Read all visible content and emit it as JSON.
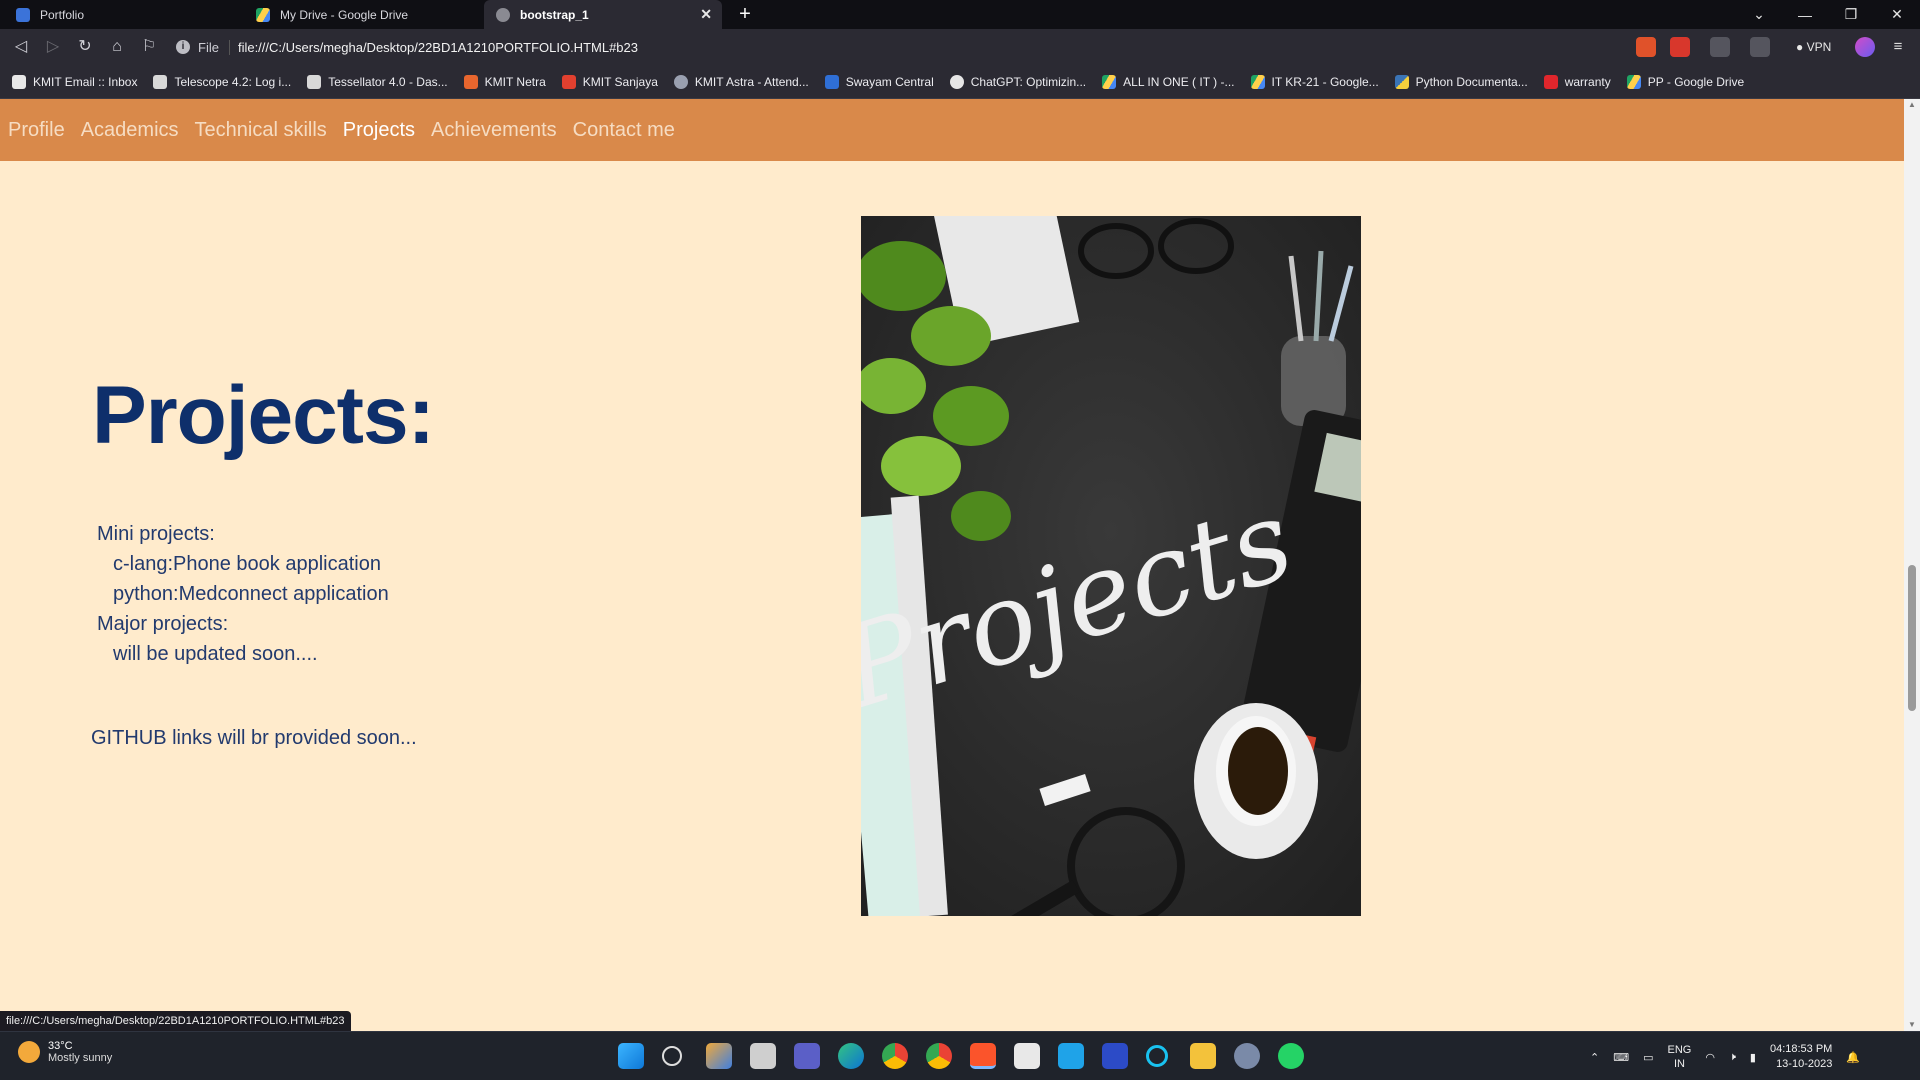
{
  "browser": {
    "tabs": [
      {
        "label": "Portfolio",
        "active": false
      },
      {
        "label": "My Drive - Google Drive",
        "active": false
      },
      {
        "label": "bootstrap_1",
        "active": true
      }
    ],
    "address": {
      "scheme_label": "File",
      "url": "file:///C:/Users/megha/Desktop/22BD1A1210PORTFOLIO.HTML#b23"
    },
    "vpn_label": "VPN",
    "bookmarks": [
      "KMIT Email :: Inbox",
      "Telescope 4.2: Log i...",
      "Tessellator 4.0 - Das...",
      "KMIT Netra",
      "KMIT Sanjaya",
      "KMIT Astra - Attend...",
      "Swayam Central",
      "ChatGPT: Optimizin...",
      "ALL IN ONE ( IT ) -...",
      "IT KR-21 - Google...",
      "Python Documenta...",
      "warranty",
      "PP - Google Drive"
    ],
    "status_url": "file:///C:/Users/megha/Desktop/22BD1A1210PORTFOLIO.HTML#b23"
  },
  "site": {
    "nav": [
      {
        "label": "Profile",
        "active": false
      },
      {
        "label": "Academics",
        "active": false
      },
      {
        "label": "Technical skills",
        "active": false
      },
      {
        "label": "Projects",
        "active": true
      },
      {
        "label": "Achievements",
        "active": false
      },
      {
        "label": "Contact me",
        "active": false
      }
    ],
    "projects": {
      "title": "Projects:",
      "mini_heading": "Mini projects:",
      "mini_items": [
        "c-lang:Phone book application",
        "python:Medconnect application"
      ],
      "major_heading": "Major projects:",
      "major_items": [
        "will be updated soon...."
      ],
      "github_note": "GITHUB links will br provided soon...",
      "image_word": "Projects"
    },
    "colors": {
      "page_background": "#ffebcc",
      "nav_background": "#d9894a",
      "title_color": "#0e2f6b"
    }
  },
  "taskbar": {
    "weather": {
      "temp": "33°C",
      "condition": "Mostly sunny"
    },
    "language": {
      "line1": "ENG",
      "line2": "IN"
    },
    "clock": {
      "time": "04:18:53 PM",
      "date": "13-10-2023"
    }
  }
}
